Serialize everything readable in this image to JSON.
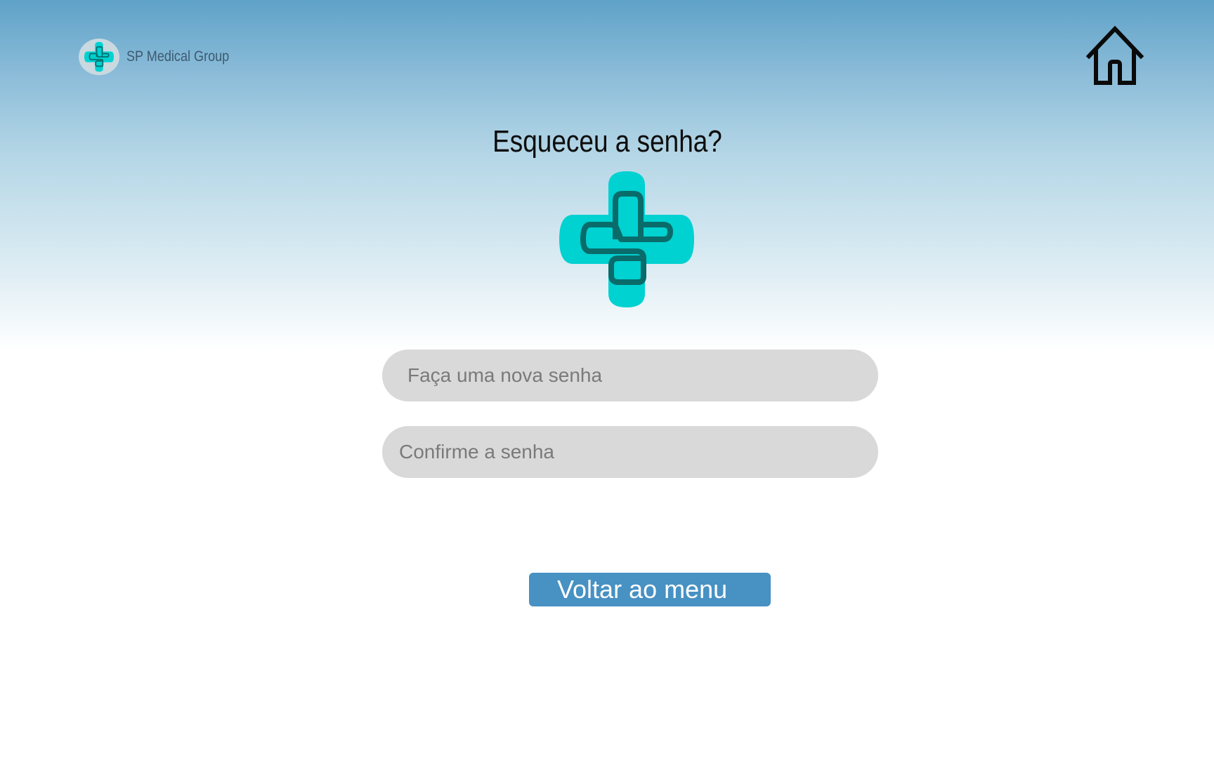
{
  "header": {
    "brand_name": "SP Medical Group",
    "logo_icon": "medical-cross-icon",
    "home_icon": "home-icon"
  },
  "main": {
    "title": "Esqueceu a senha?",
    "new_password_placeholder": "Faça uma nova senha",
    "confirm_password_placeholder": "Confirme a senha",
    "back_button_label": "Voltar ao menu"
  },
  "colors": {
    "brand_cyan": "#00d1d1",
    "brand_teal_dark": "#0a6b6b",
    "button_blue": "#4791c3",
    "header_blue": "#5fa2c8",
    "field_gray": "#d9d9d9"
  }
}
